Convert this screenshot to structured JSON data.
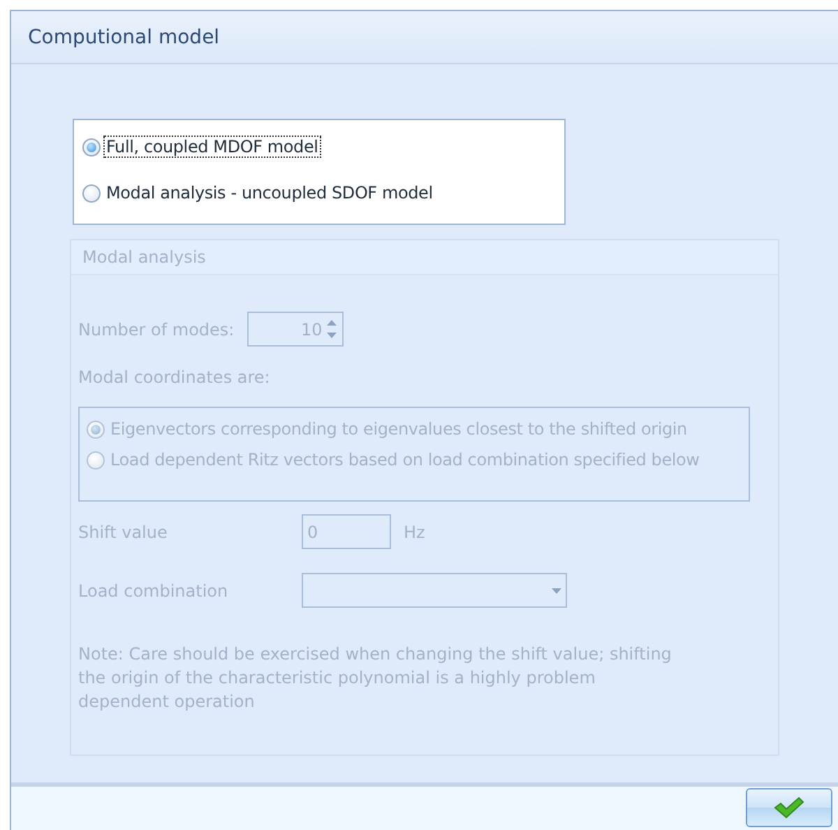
{
  "window": {
    "title": "Computional model"
  },
  "model_options": [
    {
      "label": "Full, coupled MDOF model",
      "selected": true,
      "focused": true
    },
    {
      "label": "Modal analysis - uncoupled SDOF model",
      "selected": false,
      "focused": false
    }
  ],
  "modal_analysis": {
    "title": "Modal analysis",
    "disabled": true,
    "modes_label": "Number of modes:",
    "modes_value": "10",
    "coords_label": "Modal coordinates are:",
    "coords_options": [
      {
        "label": "Eigenvectors corresponding to eigenvalues closest to the shifted origin",
        "selected": true
      },
      {
        "label": "Load dependent Ritz vectors based on load combination specified below",
        "selected": false
      }
    ],
    "shift_label": "Shift value",
    "shift_value": "0",
    "shift_unit": "Hz",
    "load_label": "Load combination",
    "note": "Note: Care should be exercised when changing the shift value; shifting the origin of the characteristic polynomial is a highly problem dependent operation"
  }
}
